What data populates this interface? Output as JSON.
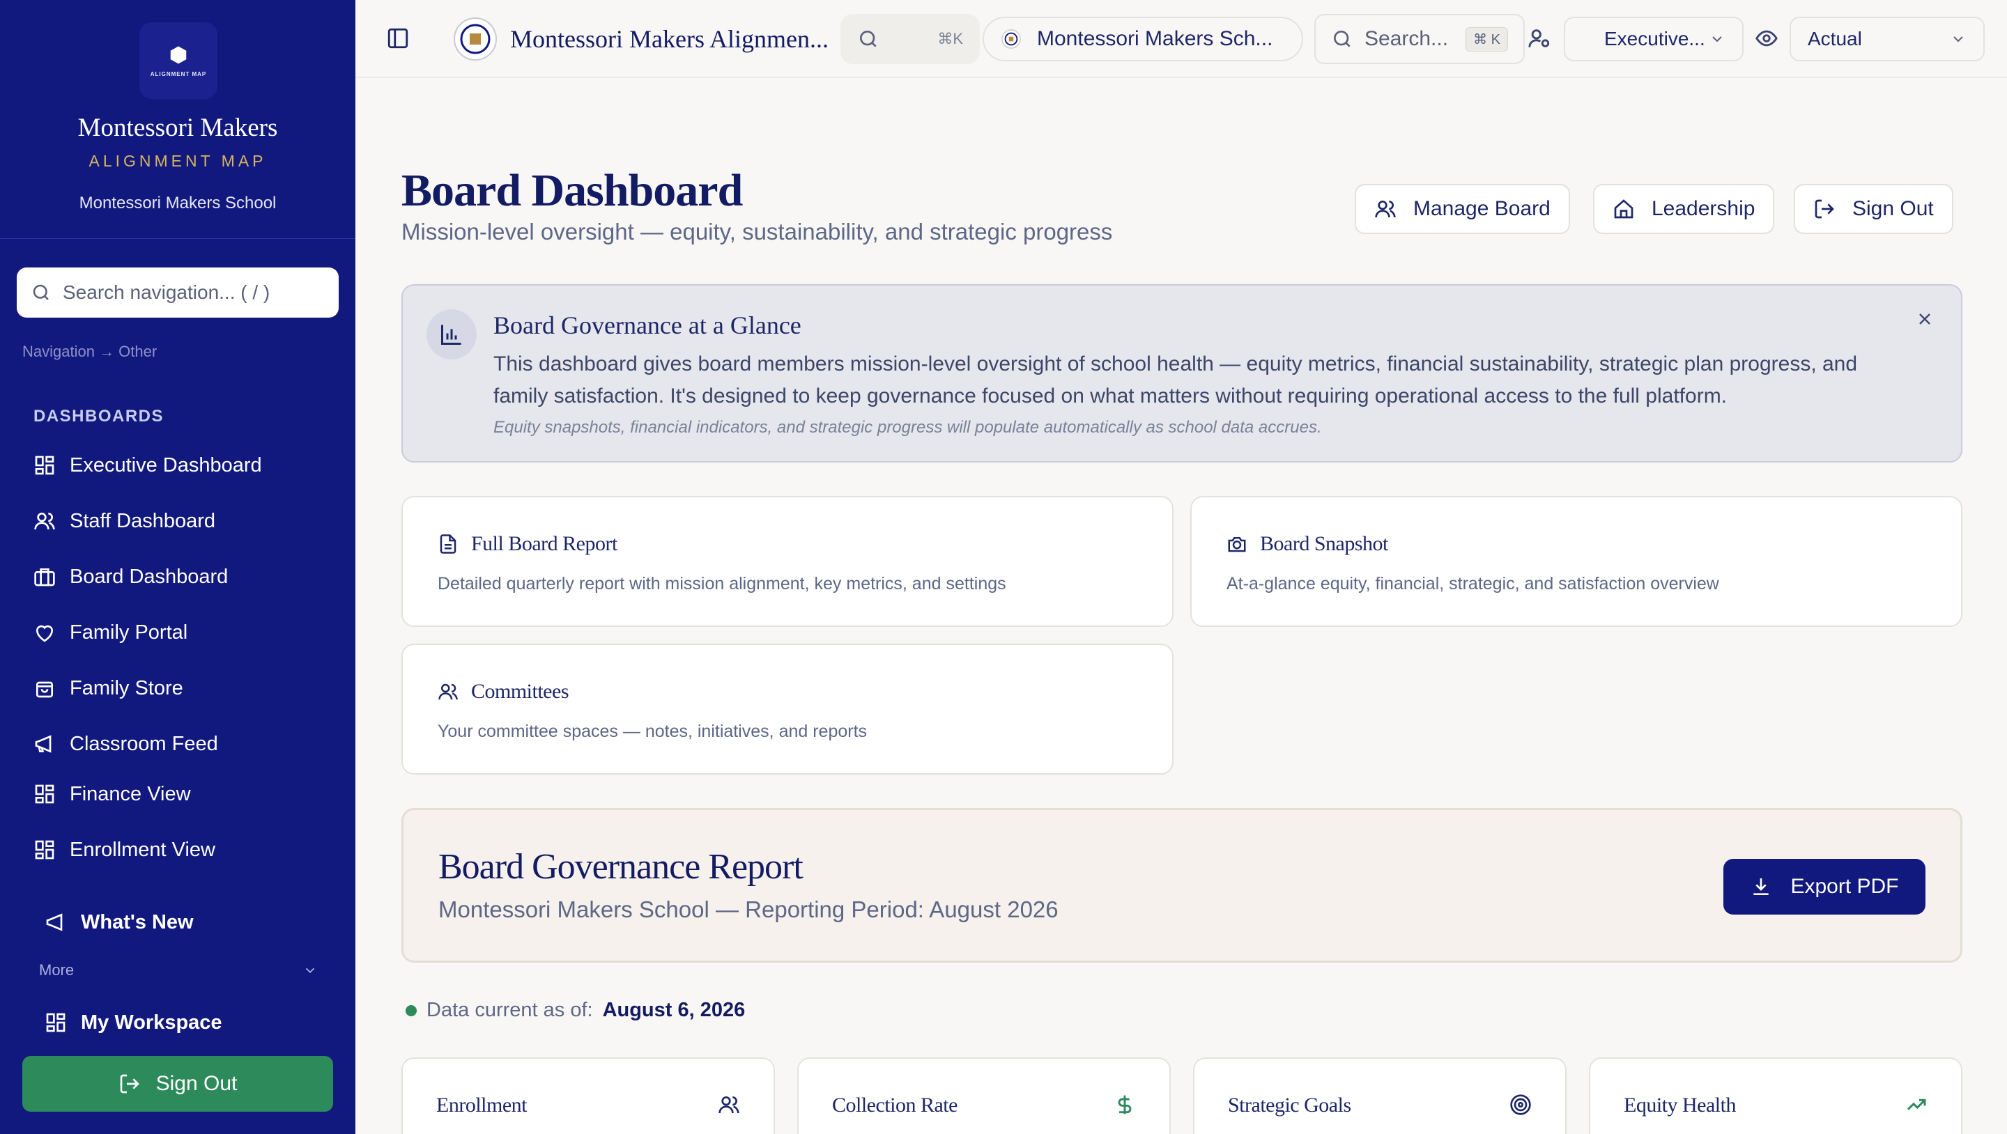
{
  "sidebar": {
    "logo_text": "ALIGNMENT MAP",
    "brand_name": "Montessori Makers",
    "brand_sub": "ALIGNMENT MAP",
    "school": "Montessori Makers School",
    "search_placeholder": "Search navigation... ( / )",
    "breadcrumb": "Navigation → Other",
    "section_heading": "DASHBOARDS",
    "items": [
      {
        "label": "Executive Dashboard",
        "icon": "grid-icon"
      },
      {
        "label": "Staff Dashboard",
        "icon": "users-icon"
      },
      {
        "label": "Board Dashboard",
        "icon": "briefcase-icon"
      },
      {
        "label": "Family Portal",
        "icon": "heart-icon"
      },
      {
        "label": "Family Store",
        "icon": "shopping-bag-icon"
      },
      {
        "label": "Classroom Feed",
        "icon": "megaphone-icon"
      },
      {
        "label": "Finance View",
        "icon": "grid-icon"
      },
      {
        "label": "Enrollment View",
        "icon": "grid-icon"
      }
    ],
    "whats_new": "What's New",
    "more_label": "More",
    "workspace": "My Workspace",
    "sign_out": "Sign Out"
  },
  "topbar": {
    "app_title": "Montessori Makers Alignmen...",
    "search_shortcut": "⌘K",
    "school_selector": "Montessori Makers Sch...",
    "search_placeholder": "Search...",
    "search_kbd": "⌘ K",
    "role_select": "Executive...",
    "view_select": "Actual"
  },
  "page": {
    "title": "Board Dashboard",
    "subtitle": "Mission-level oversight — equity, sustainability, and strategic progress",
    "buttons": {
      "manage": "Manage Board",
      "leadership": "Leadership",
      "sign_out": "Sign Out"
    }
  },
  "info_banner": {
    "title": "Board Governance at a Glance",
    "body": "This dashboard gives board members mission-level oversight of school health — equity metrics, financial sustainability, strategic plan progress, and family satisfaction. It's designed to keep governance focused on what matters without requiring operational access to the full platform.",
    "note": "Equity snapshots, financial indicators, and strategic progress will populate automatically as school data accrues."
  },
  "cards": [
    {
      "title": "Full Board Report",
      "desc": "Detailed quarterly report with mission alignment, key metrics, and settings",
      "icon": "document-icon"
    },
    {
      "title": "Board Snapshot",
      "desc": "At-a-glance equity, financial, strategic, and satisfaction overview",
      "icon": "camera-icon"
    },
    {
      "title": "Committees",
      "desc": "Your committee spaces — notes, initiatives, and reports",
      "icon": "users-icon"
    }
  ],
  "report": {
    "title": "Board Governance Report",
    "subtitle": "Montessori Makers School — Reporting Period: August 2026",
    "export": "Export PDF"
  },
  "data_current": {
    "label": "Data current as of:",
    "date": "August 6, 2026",
    "status_color": "#2d8a5b"
  },
  "metrics": [
    {
      "label": "Enrollment",
      "icon": "users-icon"
    },
    {
      "label": "Collection Rate",
      "icon": "dollar-icon"
    },
    {
      "label": "Strategic Goals",
      "icon": "target-icon"
    },
    {
      "label": "Equity Health",
      "icon": "trending-up-icon"
    }
  ],
  "colors": {
    "sidebar": "#12197e",
    "accent_green": "#2d8a5b",
    "gold": "#d7b45c",
    "navy_text": "#131b63"
  }
}
